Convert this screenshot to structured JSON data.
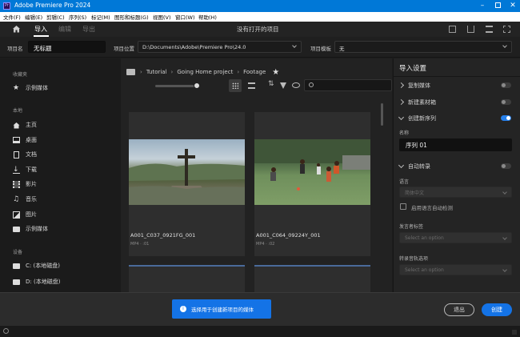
{
  "window": {
    "title": "Adobe Premiere Pro 2024",
    "app_badge": "Pr"
  },
  "menu": [
    "文件(F)",
    "编辑(E)",
    "剪辑(C)",
    "序列(S)",
    "标记(M)",
    "图形和标题(G)",
    "视图(V)",
    "窗口(W)",
    "帮助(H)"
  ],
  "nav": {
    "tabs": [
      "导入",
      "编辑",
      "导出"
    ],
    "active": "导入",
    "center_title": "没有打开的项目"
  },
  "project": {
    "name_label": "项目名",
    "name_value": "无标题",
    "location_label": "项目位置",
    "location_value": "D:\\Documents\\Adobe\\Premiere Pro\\24.0",
    "template_label": "项目模板",
    "template_value": "无"
  },
  "sidebar": {
    "favorites_header": "收藏夹",
    "favorites": [
      {
        "label": "示例媒体",
        "icon": "star-icon"
      }
    ],
    "local_header": "本地",
    "local": [
      {
        "label": "主页",
        "icon": "home-icon"
      },
      {
        "label": "桌面",
        "icon": "desktop-icon"
      },
      {
        "label": "文档",
        "icon": "document-icon"
      },
      {
        "label": "下载",
        "icon": "download-icon"
      },
      {
        "label": "影片",
        "icon": "film-icon"
      },
      {
        "label": "音乐",
        "icon": "music-icon"
      },
      {
        "label": "图片",
        "icon": "image-icon"
      },
      {
        "label": "示例媒体",
        "icon": "folder-icon"
      }
    ],
    "devices_header": "设备",
    "devices": [
      {
        "label": "C: (本地磁盘)",
        "icon": "drive-icon"
      },
      {
        "label": "D: (本地磁盘)",
        "icon": "drive-icon"
      }
    ]
  },
  "browser": {
    "breadcrumb": [
      "Tutorial",
      "Going Home project",
      "Footage"
    ],
    "clips": [
      {
        "name": "A001_C037_0921FG_001",
        "meta": "MP4 · :01",
        "thumb": "cross-hill"
      },
      {
        "name": "A001_C064_09224Y_001",
        "meta": "MP4 · :02",
        "thumb": "soccer-field"
      }
    ]
  },
  "import_settings": {
    "title": "导入设置",
    "copy_media": {
      "label": "复制媒体",
      "on": false
    },
    "new_bin": {
      "label": "新建素材箱",
      "on": false
    },
    "create_sequence": {
      "label": "创建新序列",
      "on": true
    },
    "name_label": "名称",
    "sequence_name": "序列 01",
    "auto_transcribe": {
      "label": "自动转录",
      "on": false
    },
    "language_label": "语言",
    "language_value": "简体中文",
    "auto_detect_label": "启用语言自动检测",
    "speaker_label": "发言者标签",
    "speaker_placeholder": "Select an option",
    "transcribe_options_label": "转录音轨选项",
    "transcribe_placeholder": "Select an option"
  },
  "bottom": {
    "hint": "选择用于创建新项目的媒体",
    "exit": "退出",
    "create": "创建"
  },
  "colors": {
    "accent": "#2680eb",
    "titlebar": "#0078d7",
    "hint": "#1473e6"
  }
}
